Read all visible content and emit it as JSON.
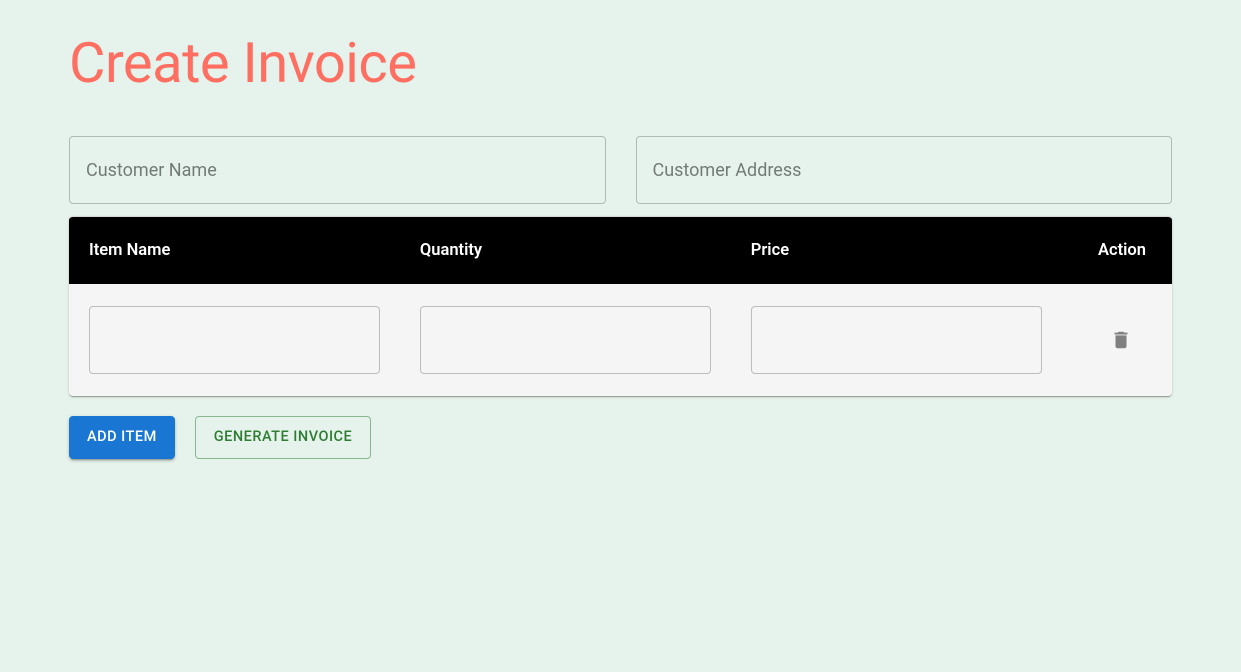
{
  "page": {
    "title": "Create Invoice"
  },
  "customer": {
    "name_placeholder": "Customer Name",
    "name_value": "",
    "address_placeholder": "Customer Address",
    "address_value": ""
  },
  "table": {
    "headers": {
      "item_name": "Item Name",
      "quantity": "Quantity",
      "price": "Price",
      "action": "Action"
    },
    "rows": [
      {
        "item_name": "",
        "quantity": "",
        "price": ""
      }
    ]
  },
  "buttons": {
    "add_item": "Add Item",
    "generate_invoice": "Generate Invoice"
  },
  "icons": {
    "delete": "trash-icon"
  },
  "colors": {
    "title": "#ff6f61",
    "background": "#e5f3ec",
    "table_header_bg": "#000000",
    "primary_button": "#1976d2",
    "success_outline": "#2e7d32"
  }
}
